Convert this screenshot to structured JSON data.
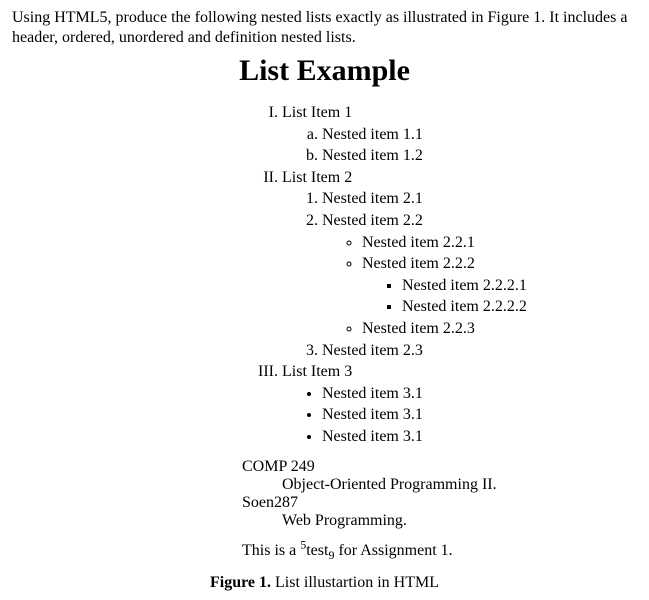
{
  "intro": "Using HTML5, produce the following nested lists exactly as illustrated in Figure 1. It includes a header, ordered, unordered and definition nested lists.",
  "title": "List Example",
  "list": {
    "i1": "List Item 1",
    "i1a": "Nested item 1.1",
    "i1b": "Nested item 1.2",
    "i2": "List Item 2",
    "i2_1": "Nested item 2.1",
    "i2_2": "Nested item 2.2",
    "i2_2_1": "Nested item 2.2.1",
    "i2_2_2": "Nested item 2.2.2",
    "i2_2_2_1": "Nested item 2.2.2.1",
    "i2_2_2_2": "Nested item 2.2.2.2",
    "i2_2_3": "Nested item 2.2.3",
    "i2_3": "Nested item 2.3",
    "i3": "List Item 3",
    "i3_1": "Nested item 3.1",
    "i3_2": "Nested item 3.1",
    "i3_3": "Nested item 3.1"
  },
  "defs": {
    "t1": "COMP 249",
    "d1": "Object-Oriented Programming II.",
    "t2": "Soen287",
    "d2": "Web Programming."
  },
  "foot": {
    "pre": "This is a ",
    "sup": "5",
    "mid": "test",
    "sub": "9",
    "post": " for Assignment 1."
  },
  "caption": {
    "label": "Figure 1.",
    "text": " List illustartion in HTML"
  }
}
